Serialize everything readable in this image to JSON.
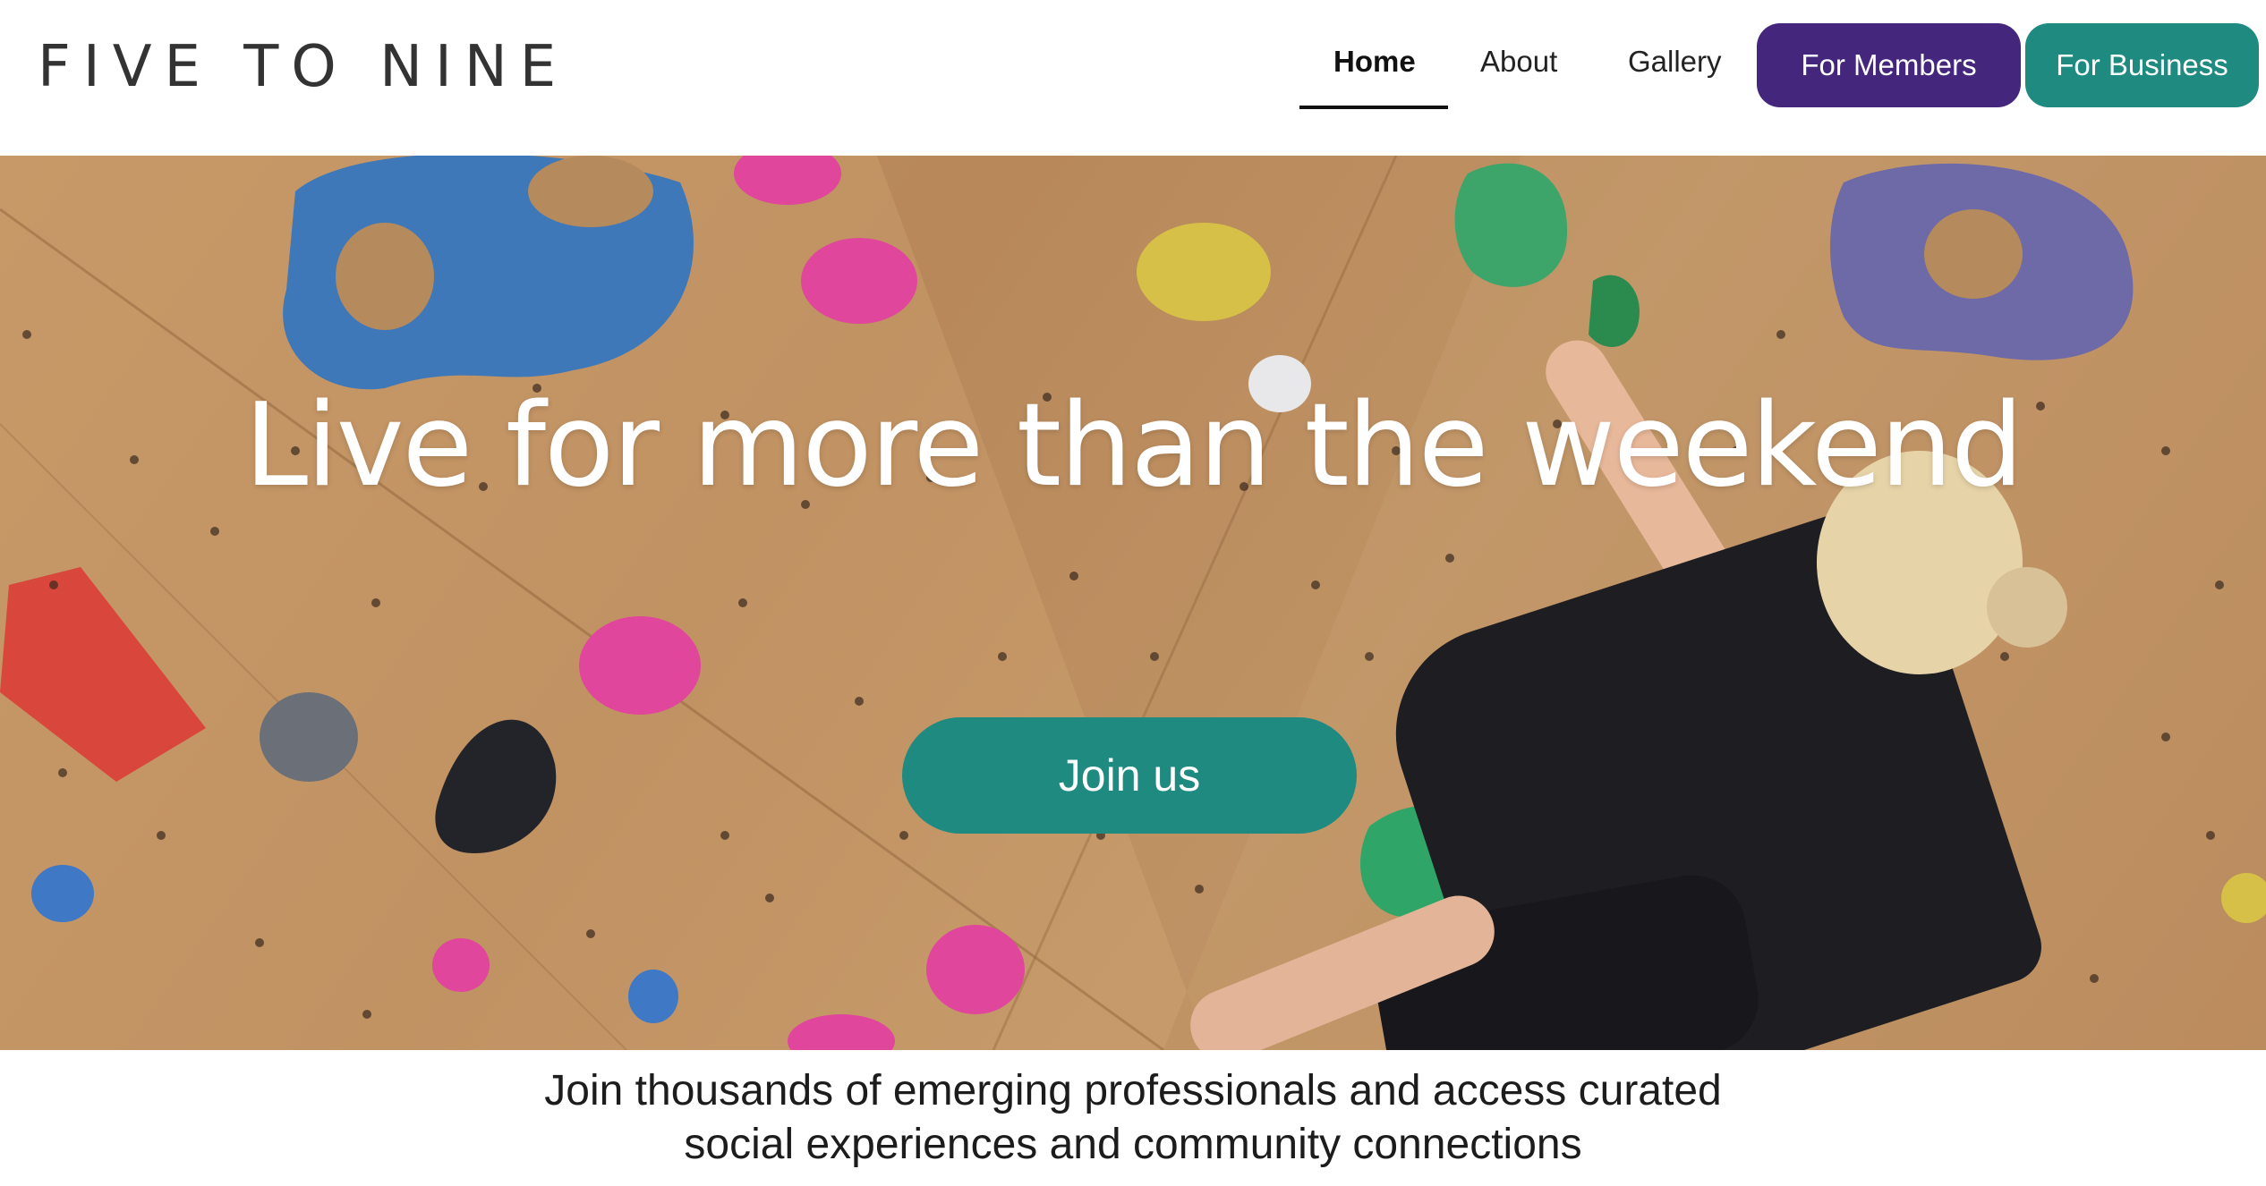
{
  "brand": {
    "logo": "FIVE TO NINE"
  },
  "nav": {
    "home": "Home",
    "about": "About",
    "gallery": "Gallery",
    "for_members": "For Members",
    "for_business": "For Business",
    "active": "Home"
  },
  "hero": {
    "title": "Live for more than the weekend",
    "cta": "Join us"
  },
  "tagline": {
    "line1": "Join thousands of emerging professionals and access curated",
    "line2": "social experiences and community connections"
  },
  "colors": {
    "members_button": "#44277d",
    "business_button": "#1f8a80",
    "cta_button": "#1f8a80",
    "wall": "#c69866"
  }
}
